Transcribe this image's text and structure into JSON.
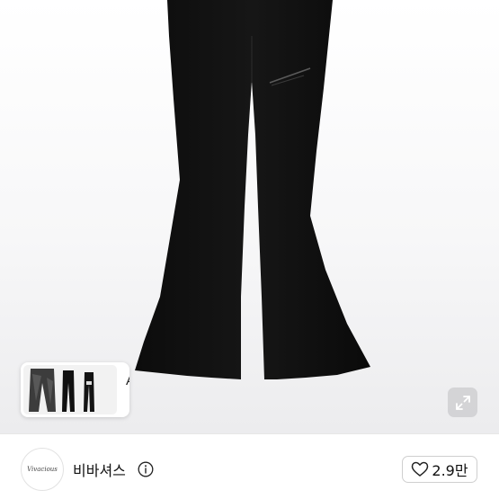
{
  "product": {
    "similar_card": {
      "ai_label": "AI",
      "chevron_icon": "chevron-right-icon"
    },
    "expand_icon": "expand-arrows-icon"
  },
  "shop": {
    "logo_text": "Vivacious",
    "name": "비바셔스",
    "info_icon": "info-icon",
    "like": {
      "icon": "heart-outline-icon",
      "count": "2.9만"
    }
  }
}
